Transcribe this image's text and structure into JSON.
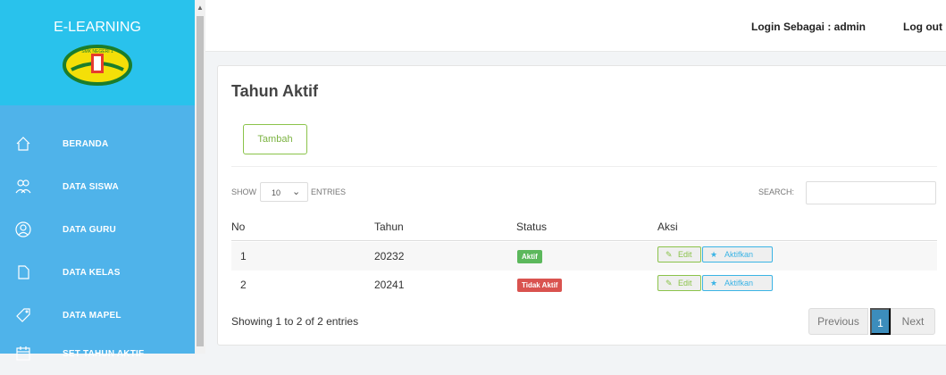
{
  "sidebar": {
    "brand": "E-LEARNING",
    "logo_text": "SMK NEGERI 1",
    "items": [
      {
        "label": "BERANDA",
        "icon": "home-icon"
      },
      {
        "label": "DATA SISWA",
        "icon": "users-icon"
      },
      {
        "label": "DATA GURU",
        "icon": "person-icon"
      },
      {
        "label": "DATA KELAS",
        "icon": "document-icon"
      },
      {
        "label": "DATA MAPEL",
        "icon": "tag-icon"
      },
      {
        "label": "SET TAHUN AKTIF",
        "icon": "calendar-icon"
      }
    ]
  },
  "topbar": {
    "login_as": "Login Sebagai : admin",
    "logout": "Log out"
  },
  "page": {
    "title": "Tahun Aktif",
    "add_button": "Tambah",
    "show_label": "SHOW",
    "entries_value": "10",
    "entries_label": "ENTRIES",
    "search_label": "SEARCH:",
    "columns": [
      "No",
      "Tahun",
      "Status",
      "Aksi"
    ],
    "rows": [
      {
        "no": "1",
        "year": "20232",
        "status": "Aktif",
        "edit": "Edit",
        "activate": "Aktifkan"
      },
      {
        "no": "2",
        "year": "20241",
        "status": "Tidak Aktif",
        "edit": "Edit",
        "activate": "Aktifkan"
      }
    ],
    "info": "Showing 1 to 2 of 2 entries",
    "pagination": {
      "previous": "Previous",
      "current": "1",
      "next": "Next"
    }
  },
  "colors": {
    "sidebar": "#4fb3ea",
    "sidebar_header": "#29c2ec",
    "active_status": "#5cb85c",
    "inactive_status": "#d9534f",
    "edit_button": "#8bc34a",
    "activate_button": "#3bb4e5",
    "pagination_active": "#3c8dbc"
  }
}
